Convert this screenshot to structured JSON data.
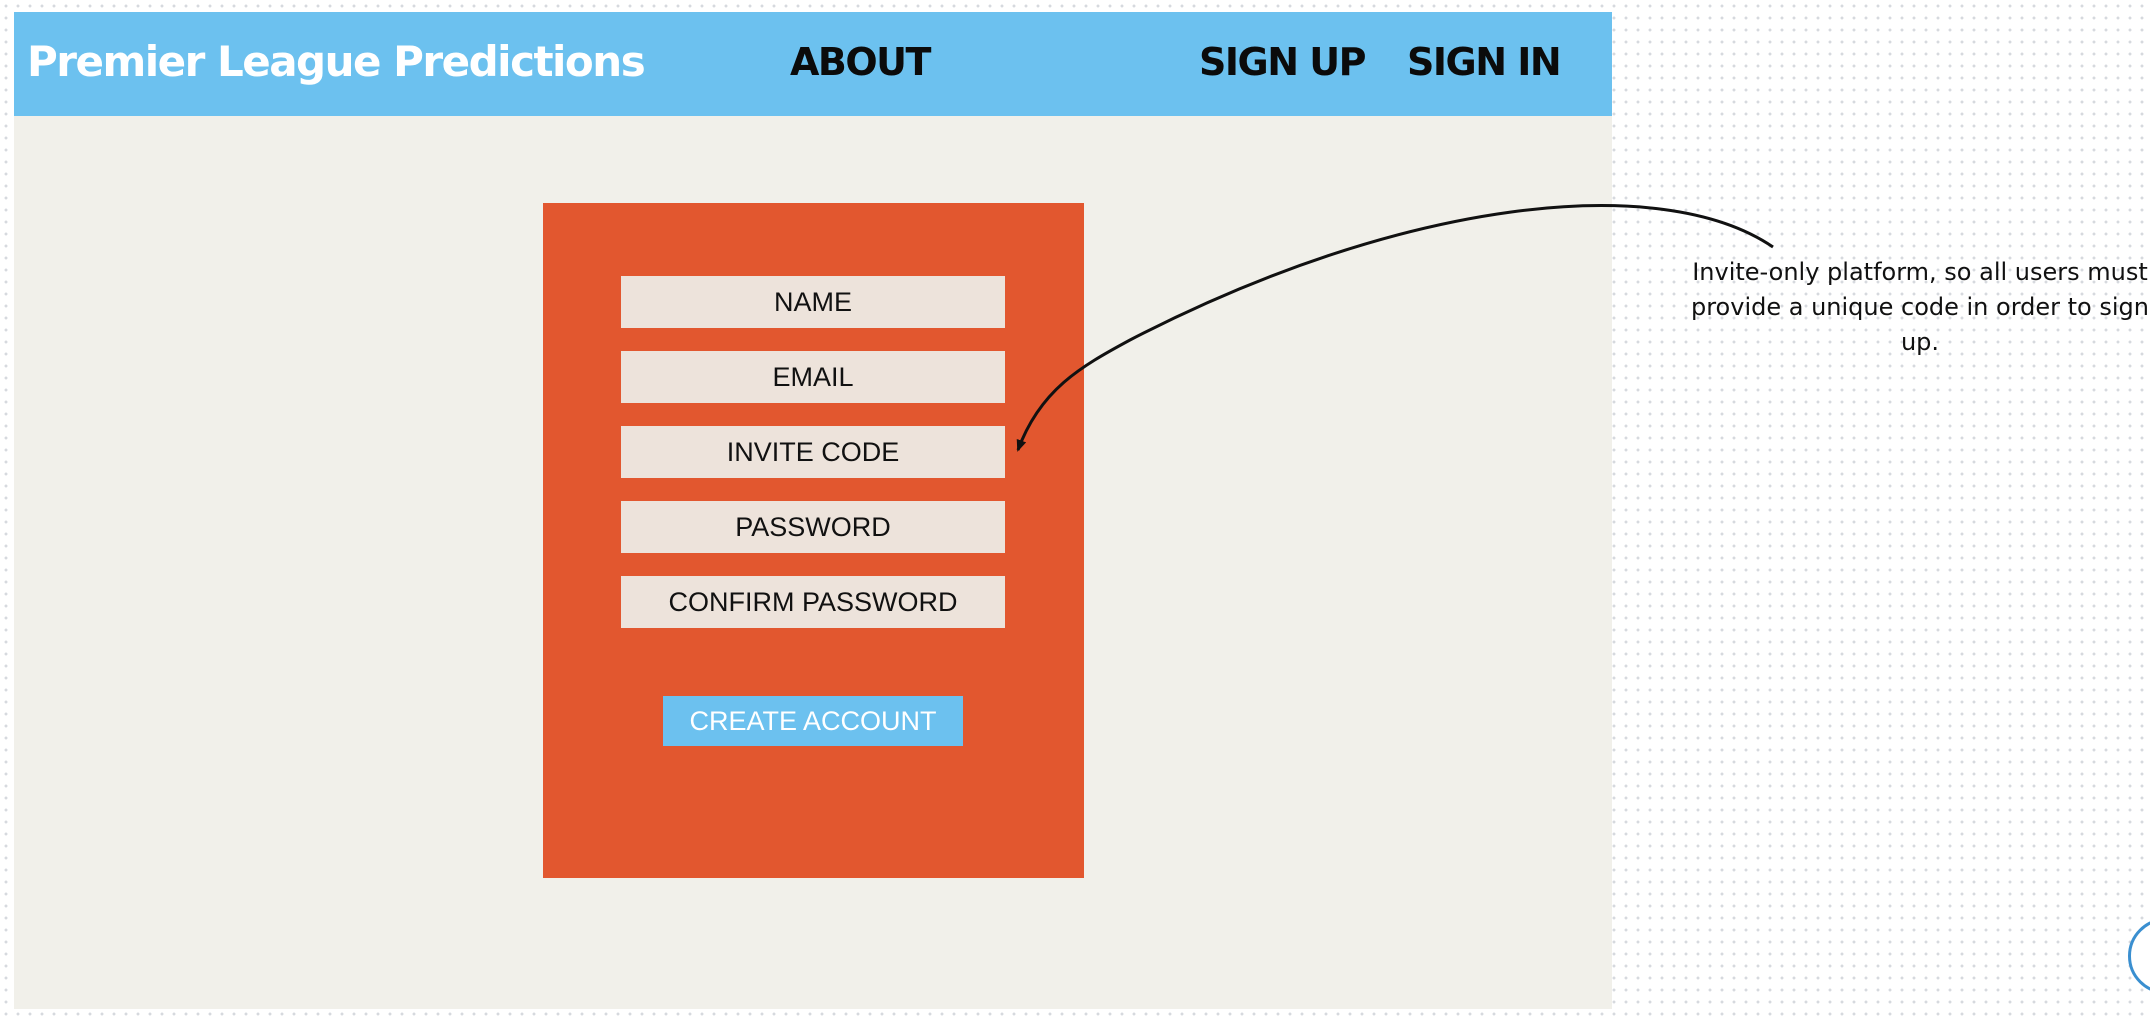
{
  "navbar": {
    "brand": "Premier League Predictions",
    "about": "ABOUT",
    "sign_up": "SIGN UP",
    "sign_in": "SIGN IN"
  },
  "signup_form": {
    "fields": [
      {
        "label": "NAME"
      },
      {
        "label": "EMAIL"
      },
      {
        "label": "INVITE CODE"
      },
      {
        "label": "PASSWORD"
      },
      {
        "label": "CONFIRM PASSWORD"
      }
    ],
    "submit_label": "CREATE ACCOUNT"
  },
  "annotation": {
    "text": "Invite-only platform, so all users must provide a unique code in order to sign up."
  },
  "colors": {
    "navbar_bg": "#6cc1ef",
    "frame_bg": "#f1f0ea",
    "card_bg": "#e2572f",
    "field_bg": "#ede3db",
    "button_bg": "#6cc1ef"
  }
}
